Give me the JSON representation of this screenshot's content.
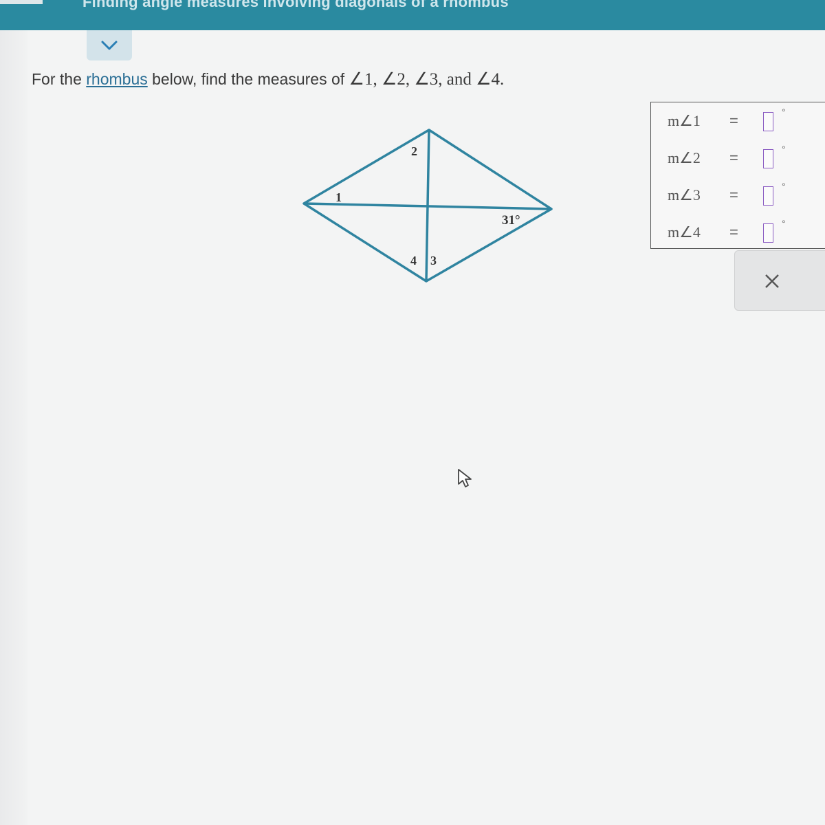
{
  "header": {
    "title": "Finding angle measures involving diagonals of a rhombus"
  },
  "collapse_tab": {
    "icon": "chevron-down-icon"
  },
  "prompt": {
    "before": "For the ",
    "link": "rhombus",
    "after": " below, find the measures of ",
    "angles": "∠1, ∠2, ∠3, and ∠4."
  },
  "diagram": {
    "labels": {
      "angle1": "1",
      "angle2": "2",
      "angle3": "3",
      "angle4": "4",
      "given": "31°"
    },
    "stroke_color": "#2f84a0"
  },
  "answers": [
    {
      "label": "m∠1",
      "equals": "=",
      "value": "",
      "unit": "°"
    },
    {
      "label": "m∠2",
      "equals": "=",
      "value": "",
      "unit": "°"
    },
    {
      "label": "m∠3",
      "equals": "=",
      "value": "",
      "unit": "°"
    },
    {
      "label": "m∠4",
      "equals": "=",
      "value": "",
      "unit": "°"
    }
  ],
  "actions": {
    "clear_icon": "close-icon"
  },
  "colors": {
    "header": "#2a8aa0",
    "link": "#2a6e95",
    "input_border": "#8a5bc2"
  }
}
